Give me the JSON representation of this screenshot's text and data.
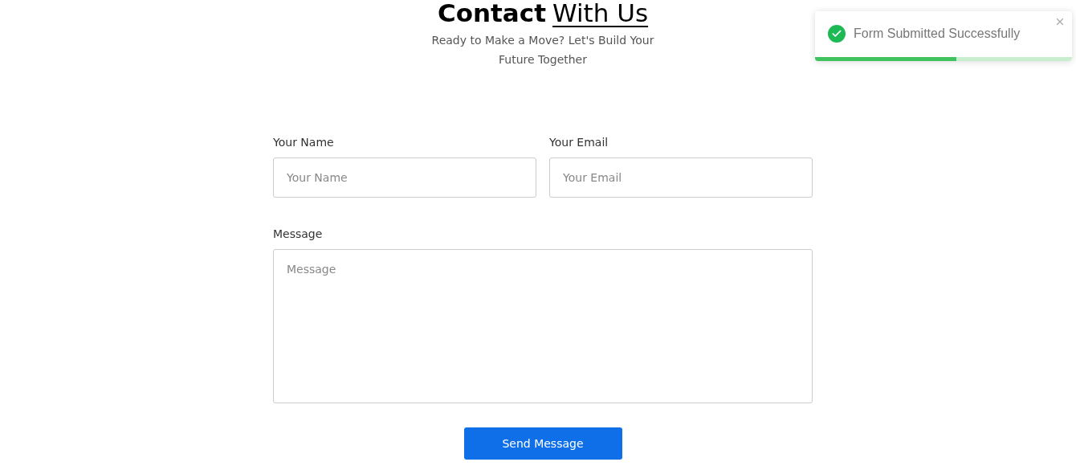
{
  "heading": {
    "bold": "Contact",
    "underlined": "With Us"
  },
  "subtitle": "Ready to Make a Move? Let's Build Your Future Together",
  "form": {
    "fields": [
      {
        "kind": "input",
        "label": "Your Name",
        "placeholder": "Your Name"
      },
      {
        "kind": "input",
        "label": "Your Email",
        "placeholder": "Your Email"
      },
      {
        "kind": "textarea",
        "label": "Message",
        "placeholder": "Message"
      }
    ],
    "submit": "Send Message"
  },
  "toast": {
    "message": "Form Submitted Successfully",
    "level": 0.55
  }
}
